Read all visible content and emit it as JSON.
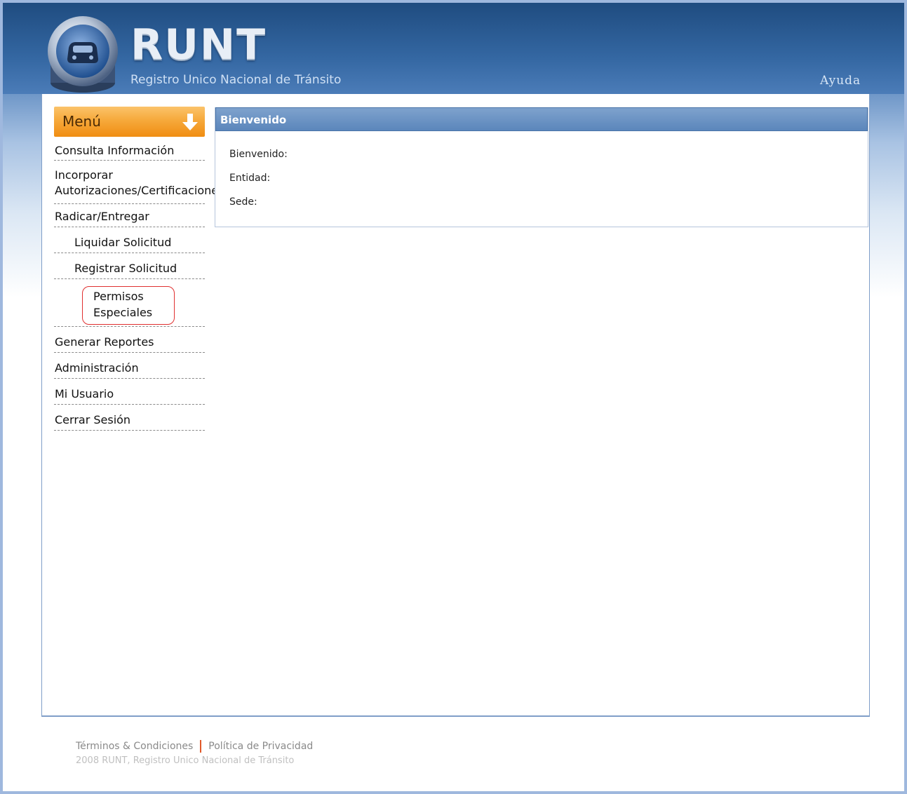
{
  "header": {
    "brand": "RUNT",
    "subtitle": "Registro Unico Nacional de Tránsito",
    "help_label": "Ayuda"
  },
  "menu": {
    "title": "Menú",
    "items": [
      {
        "label": "Consulta Información"
      },
      {
        "label_line1": "Incorporar",
        "label_line2": "Autorizaciones/Certificaciones"
      },
      {
        "label": "Radicar/Entregar"
      },
      {
        "label": "Liquidar Solicitud"
      },
      {
        "label": "Registrar Solicitud"
      },
      {
        "label_line1": "Permisos",
        "label_line2": "Especiales"
      },
      {
        "label": "Generar Reportes"
      },
      {
        "label": "Administración"
      },
      {
        "label": "Mi Usuario"
      },
      {
        "label": "Cerrar Sesión"
      }
    ]
  },
  "welcome": {
    "title": "Bienvenido",
    "fields": [
      {
        "label": "Bienvenido:"
      },
      {
        "label": "Entidad:"
      },
      {
        "label": "Sede:"
      }
    ]
  },
  "footer": {
    "terms": "Términos & Condiciones",
    "privacy": "Política de Privacidad",
    "copyright": "2008 RUNT, Registro Unico Nacional de Tránsito"
  },
  "colors": {
    "header_blue": "#2d5c93",
    "menu_orange": "#f6a93b",
    "title_bar_blue": "#5b86bb",
    "highlight_red": "#e03030"
  },
  "icons": [
    "runt-car-logo-icon",
    "arrow-down-icon"
  ]
}
